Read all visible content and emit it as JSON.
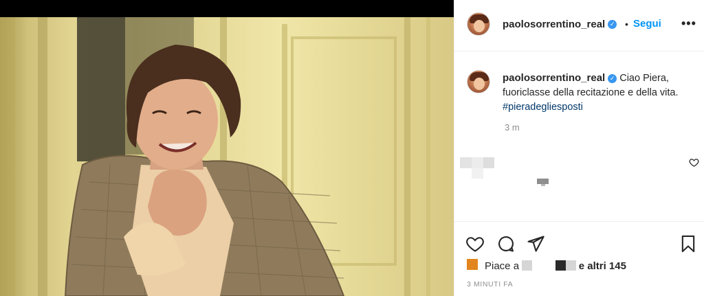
{
  "post": {
    "image_alt": "",
    "author": "paolosorrentino_real",
    "follow_label": "Segui",
    "separator": "•",
    "more_label": "•••",
    "caption_text": "Ciao Piera, fuoriclasse della recitazione e della vita.",
    "hashtag": "#pieradegliesposti",
    "caption_time": "3 m",
    "likes_prefix": "Piace a",
    "likes_suffix": "e altri 145",
    "post_time": "3 MINUTI FA"
  },
  "icons": {
    "verified": "verified-badge-icon",
    "like": "heart-icon",
    "comment": "comment-icon",
    "share": "paper-plane-icon",
    "save": "bookmark-icon",
    "options": "more-dots-icon"
  },
  "colors": {
    "link_blue": "#0095f6",
    "hashtag": "#00376b",
    "muted": "#8e8e8e",
    "text": "#262626",
    "verified": "#3897f0"
  }
}
